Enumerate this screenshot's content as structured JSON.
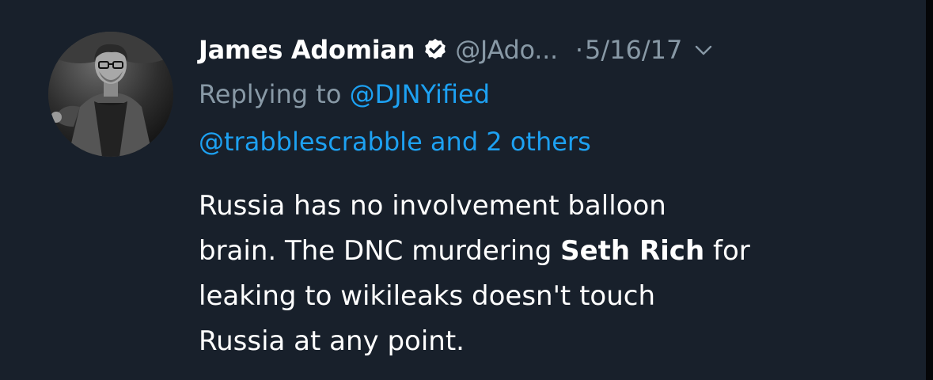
{
  "tweet": {
    "author_name": "James Adomian",
    "author_handle": "@JAdo...",
    "dot": "·",
    "date": "5/16/17",
    "verified_icon": "verified-badge-icon",
    "menu_icon": "chevron-down-icon",
    "reply_prefix": "Replying to ",
    "reply_mention_1": "@DJNYified",
    "reply_mention_2": "@trabblescrabble",
    "reply_suffix": " and 2 others",
    "body": {
      "line1": "Russia has no involvement balloon",
      "line2_a": "brain. The DNC murdering ",
      "line2_bold": "Seth Rich",
      "line2_b": " for",
      "line3": "leaking to wikileaks doesn't touch",
      "line4": "Russia at any point."
    }
  },
  "colors": {
    "background": "#18202b",
    "text_primary": "#ffffff",
    "text_secondary": "#8899a6",
    "link": "#1da1f2"
  }
}
